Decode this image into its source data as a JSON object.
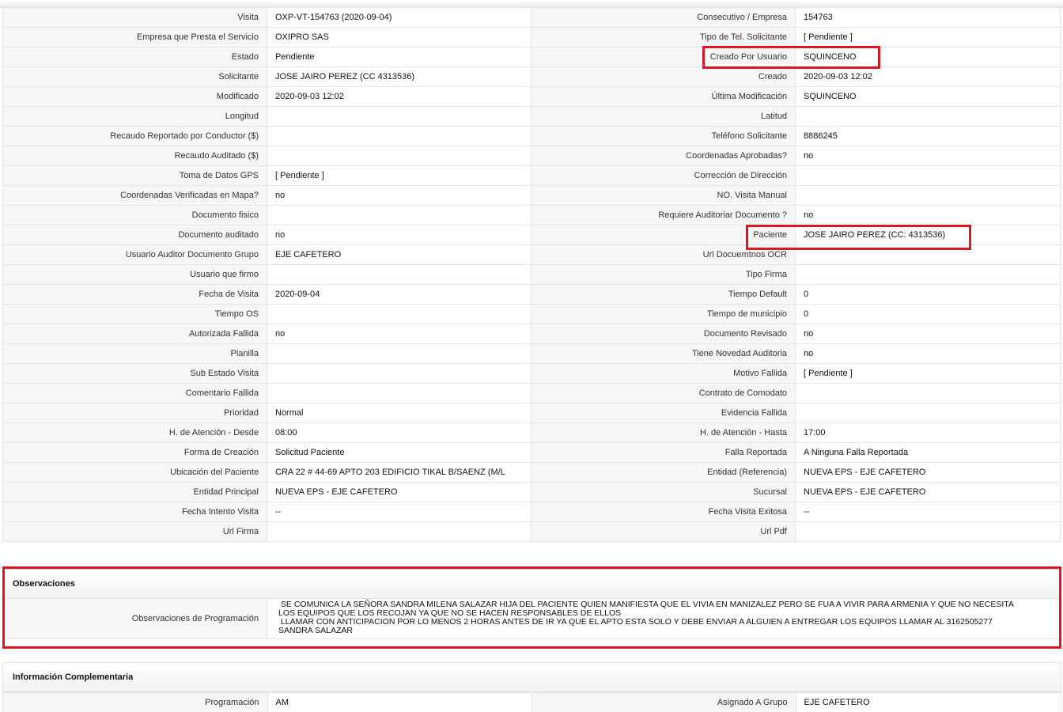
{
  "rows": [
    {
      "l1": "Visita",
      "v1": "OXP-VT-154763 (2020-09-04)",
      "l2": "Consecutivo / Empresa",
      "v2": "154763"
    },
    {
      "l1": "Empresa que Presta el Servicio",
      "v1": "OXIPRO SAS",
      "l2": "Tipo de Tel. Solicitante",
      "v2": "[ Pendiente ]"
    },
    {
      "l1": "Estado",
      "v1": "Pendiente",
      "l2": "Creado Por Usuario",
      "v2": "SQUINCENO"
    },
    {
      "l1": "Solicitante",
      "v1": "JOSE JAIRO PEREZ (CC 4313536)",
      "l2": "Creado",
      "v2": "2020-09-03 12:02"
    },
    {
      "l1": "Modificado",
      "v1": "2020-09-03 12:02",
      "l2": "Última Modificación",
      "v2": " SQUINCENO"
    },
    {
      "l1": "Longitud",
      "v1": "",
      "l2": "Latitud",
      "v2": ""
    },
    {
      "l1": "Recaudo Reportado por Conductor ($)",
      "v1": "",
      "l2": "Teléfono Solicitante",
      "v2": "8886245"
    },
    {
      "l1": "Recaudo Auditado ($)",
      "v1": "",
      "l2": "Coordenadas Aprobadas?",
      "v2": " no"
    },
    {
      "l1": "Toma de Datos GPS",
      "v1": "[ Pendiente ]",
      "l2": "Corrección de Dirección",
      "v2": ""
    },
    {
      "l1": "Coordenadas Verificadas en Mapa?",
      "v1": " no",
      "l2": "NO. Visita Manual",
      "v2": ""
    },
    {
      "l1": "Documento fisico",
      "v1": "",
      "l2": "Requiere Auditoriar Documento ?",
      "v2": " no"
    },
    {
      "l1": "Documento auditado",
      "v1": " no",
      "l2": "Paciente",
      "v2": "JOSE JAIRO PEREZ (CC: 4313536)"
    },
    {
      "l1": "Usuario Auditor Documento Grupo",
      "v1": "EJE CAFETERO",
      "l2": "Url Docuemtnos OCR",
      "v2": ""
    },
    {
      "l1": "Usuario que firmo",
      "v1": "",
      "l2": "Tipo Firma",
      "v2": ""
    },
    {
      "l1": "Fecha de Visita",
      "v1": " 2020-09-04",
      "l2": "Tiempo Default",
      "v2": "0"
    },
    {
      "l1": "Tiempo OS",
      "v1": "",
      "l2": "Tiempo de municipio",
      "v2": "0"
    },
    {
      "l1": "Autorizada Fallida",
      "v1": "no",
      "l2": "Documento Revisado",
      "v2": " no"
    },
    {
      "l1": "Planilla",
      "v1": "",
      "l2": "Tiene Novedad Auditoria",
      "v2": " no"
    },
    {
      "l1": "Sub Estado Visita",
      "v1": "",
      "l2": "Motivo Fallida",
      "v2": "[ Pendiente ]"
    },
    {
      "l1": "Comentario Fallida",
      "v1": "",
      "l2": "Contrato de Comodato",
      "v2": ""
    },
    {
      "l1": "Prioridad",
      "v1": "Normal",
      "l2": "Evidencia Fallida",
      "v2": ""
    },
    {
      "l1": "H. de Atención - Desde",
      "v1": "08:00",
      "l2": "H. de Atención - Hasta",
      "v2": "17:00"
    },
    {
      "l1": "Forma de Creación",
      "v1": "Solicitud Paciente",
      "l2": "Falla Reportada",
      "v2": "A Ninguna Falla Reportada"
    },
    {
      "l1": "Ubicación del Paciente",
      "v1": "CRA 22 # 44-69 APTO 203 EDIFICIO TIKAL B/SAENZ (M/L",
      "l2": "Entidad (Referencia)",
      "v2": "NUEVA EPS - EJE CAFETERO"
    },
    {
      "l1": "Entidad Principal",
      "v1": "NUEVA EPS - EJE CAFETERO",
      "l2": "Sucursal",
      "v2": "NUEVA EPS - EJE CAFETERO"
    },
    {
      "l1": "Fecha Intento Visita",
      "v1": "--",
      "l2": "Fecha Visita Exitosa",
      "v2": "--"
    },
    {
      "l1": "Url Firma",
      "v1": "",
      "l2": "Url Pdf",
      "v2": ""
    }
  ],
  "observaciones": {
    "title": "Observaciones",
    "label": "Observaciones de Programación",
    "lines": [
      " SE COMUNICA LA SEÑORA SANDRA MILENA SALAZAR HIJA DEL PACIENTE QUIEN MANIFIESTA QUE EL VIVIA EN MANIZALEZ PERO SE FUA A VIVIR PARA ARMENIA Y QUE NO NECESITA",
      "LOS EQUIPOS QUE LOS RECOJAN YA QUE NO SE HACEN RESPONSABLES DE ELLOS",
      " LLAMAR CON ANTICIPACION POR LO MENOS 2 HORAS ANTES DE IR YA QUE EL APTO ESTA SOLO Y DEBE ENVIAR A ALGUIEN A ENTREGAR LOS EQUIPOS LLAMAR AL 3162505277",
      "SANDRA SALAZAR"
    ]
  },
  "complementaria": {
    "title": "Información Complementaria",
    "row": {
      "l1": "Programación",
      "v1": "AM",
      "l2": "Asignado A Grupo",
      "v2": "EJE CAFETERO"
    }
  },
  "colors": {
    "highlight": "#e0151f",
    "label_bg": "#f6f6f6",
    "border": "#e3e3e3"
  }
}
